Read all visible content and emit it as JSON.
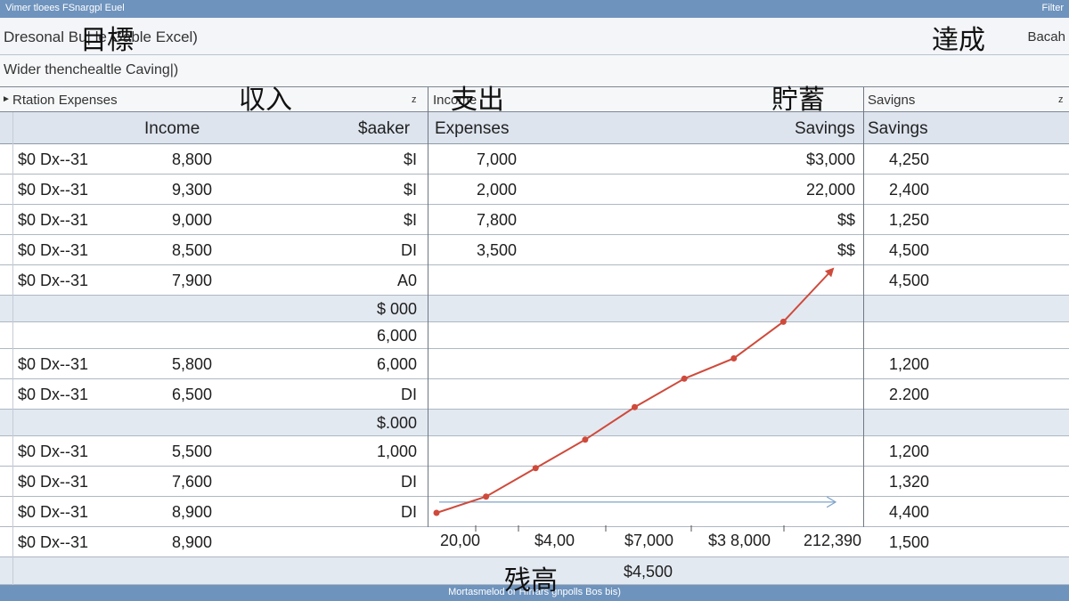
{
  "app": {
    "window_title": "Vimer tloees FSnargpl Euel",
    "window_right": "Filter",
    "sheet_title": "Dresonal  Bu|  le  Gable Excel)",
    "sheet_right": "Bacah",
    "subtitle": "Wider thenchealtle Caving|)",
    "status_bar": "Mortasmelod or Hfrrars gnpolls Bos bis)"
  },
  "jp_labels": {
    "goal": "目標",
    "achievement": "達成",
    "income": "収入",
    "expenses": "支出",
    "savings": "貯蓄",
    "balance": "残高"
  },
  "header_row1": {
    "left_label": "Rtation Expenses",
    "left_sort": "z",
    "mid_label": "Income",
    "mid_sort": "",
    "right_label": "Savigns",
    "right_sort": "z"
  },
  "header_row2": {
    "income": "Income",
    "salary": "$aaker",
    "expenses": "Expenses",
    "savings": "Savings",
    "savings2": "Savings"
  },
  "rows": [
    {
      "label": "$0 Dx--31",
      "income": "8,800",
      "c3": "$I",
      "expenses": "7,000",
      "c5": "$3,000",
      "savings": "4,250",
      "band": false
    },
    {
      "label": "$0 Dx--31",
      "income": "9,300",
      "c3": "$I",
      "expenses": "2,000",
      "c5": "22,000",
      "savings": "2,400",
      "band": false
    },
    {
      "label": "$0 Dx--31",
      "income": "9,000",
      "c3": "$I",
      "expenses": "7,800",
      "c5": "$$",
      "savings": "1,250",
      "band": false
    },
    {
      "label": "$0 Dx--31",
      "income": "8,500",
      "c3": "DI",
      "expenses": "3,500",
      "c5": "$$",
      "savings": "4,500",
      "band": false
    },
    {
      "label": "$0 Dx--31",
      "income": "7,900",
      "c3": "A0",
      "expenses": "",
      "c5": "",
      "savings": "4,500",
      "band": false
    },
    {
      "label": "",
      "income": "",
      "c3": "$ 000",
      "expenses": "",
      "c5": "",
      "savings": "",
      "band": true
    },
    {
      "label": "",
      "income": "",
      "c3": "6,000",
      "expenses": "",
      "c5": "",
      "savings": "",
      "band": false
    },
    {
      "label": "$0 Dx--31",
      "income": "5,800",
      "c3": "6,000",
      "expenses": "",
      "c5": "",
      "savings": "1,200",
      "band": false
    },
    {
      "label": "$0 Dx--31",
      "income": "6,500",
      "c3": "DI",
      "expenses": "",
      "c5": "",
      "savings": "2.200",
      "band": false
    },
    {
      "label": "",
      "income": "",
      "c3": "$.000",
      "expenses": "",
      "c5": "",
      "savings": "",
      "band": true
    },
    {
      "label": "$0 Dx--31",
      "income": "5,500",
      "c3": "1,000",
      "expenses": "",
      "c5": "",
      "savings": "1,200",
      "band": false
    },
    {
      "label": "$0 Dx--31",
      "income": "7,600",
      "c3": "DI",
      "expenses": "",
      "c5": "",
      "savings": "1,320",
      "band": false
    },
    {
      "label": "$0 Dx--31",
      "income": "8,900",
      "c3": "DI",
      "expenses": "",
      "c5": "",
      "savings": "4,400",
      "band": false
    },
    {
      "label": "$0 Dx--31",
      "income": "8,900",
      "c3": "",
      "expenses": "",
      "c5": "",
      "savings": "1,500",
      "band": false
    },
    {
      "label": "",
      "income": "",
      "c3": "",
      "expenses": "",
      "c5": "",
      "savings": "",
      "band": true
    }
  ],
  "chart_data": {
    "type": "line",
    "title": "",
    "xlabel": "",
    "ylabel": "",
    "x_tick_labels": [
      "20,00",
      "$4,00",
      "$7,000",
      "$3 8,000",
      "212,390"
    ],
    "series": [
      {
        "values": [
          0,
          4,
          11,
          18,
          26,
          33,
          38,
          47,
          60
        ],
        "color": "#cf4a3b"
      },
      {
        "values": [
          2,
          2
        ],
        "color": "#7fa3c9"
      }
    ],
    "ylim": [
      0,
      60
    ],
    "bottom_value": "$4,500"
  }
}
